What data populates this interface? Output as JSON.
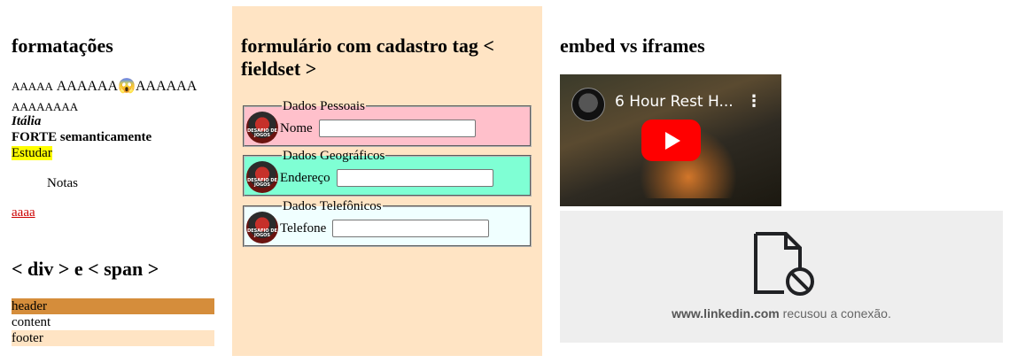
{
  "formatting": {
    "heading": "formatações",
    "line1_small": "AAAAA",
    "line1_medium_left": "AAAAAA",
    "line1_emoji": "😱",
    "line1_medium_right": "AAAAAA",
    "line2": "AAAAAAAA",
    "italic_bold": "Itália",
    "strong_word": "FORTE",
    "strong_rest": "semanticamente",
    "marked": "Estudar",
    "indented": "Notas",
    "link": "aaaa"
  },
  "divspan": {
    "heading": "< div > e < span >",
    "rows": [
      {
        "label": "header",
        "color": "#d58d3b"
      },
      {
        "label": "content",
        "color": "#ffffff"
      },
      {
        "label": "footer",
        "color": "#ffe4c4"
      }
    ]
  },
  "form": {
    "heading_line1": "formulário com cadastro tag <",
    "heading_line2": "fieldset >",
    "logo_text": "DESAFIO DE JOGOS",
    "fieldsets": [
      {
        "legend": "Dados Pessoais",
        "label": "Nome",
        "bg": "#ffc0cb"
      },
      {
        "legend": "Dados Geográficos",
        "label": "Endereço",
        "bg": "#7fffd4"
      },
      {
        "legend": "Dados Telefônicos",
        "label": "Telefone",
        "bg": "#f0ffff"
      }
    ]
  },
  "embed": {
    "heading": "embed vs iframes",
    "video_title": "6 Hour Rest H...",
    "blocked_domain": "www.linkedin.com",
    "blocked_message": "recusou a conexão.",
    "blocked_icon": "blocked-file-icon"
  }
}
